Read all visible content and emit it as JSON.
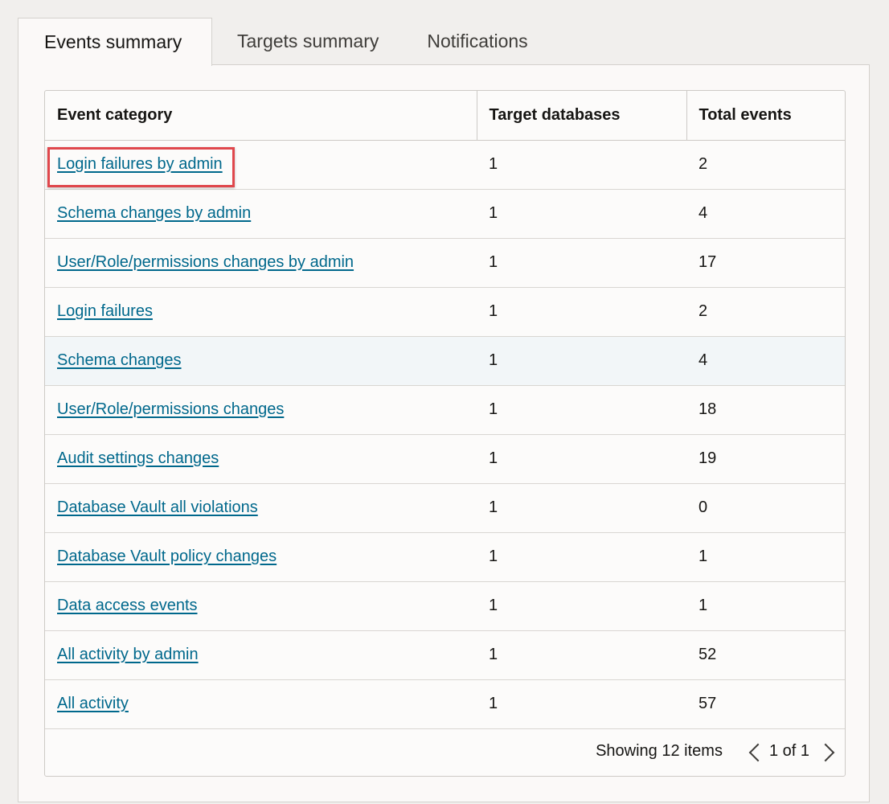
{
  "tabs": [
    {
      "label": "Events summary"
    },
    {
      "label": "Targets summary"
    },
    {
      "label": "Notifications"
    }
  ],
  "table": {
    "headers": [
      "Event category",
      "Target databases",
      "Total events"
    ],
    "rows": [
      {
        "category": "Login failures by admin",
        "targets": "1",
        "total": "2"
      },
      {
        "category": "Schema changes by admin",
        "targets": "1",
        "total": "4"
      },
      {
        "category": "User/Role/permissions changes by admin",
        "targets": "1",
        "total": "17"
      },
      {
        "category": "Login failures",
        "targets": "1",
        "total": "2"
      },
      {
        "category": "Schema changes",
        "targets": "1",
        "total": "4"
      },
      {
        "category": "User/Role/permissions changes",
        "targets": "1",
        "total": "18"
      },
      {
        "category": "Audit settings changes",
        "targets": "1",
        "total": "19"
      },
      {
        "category": "Database Vault all violations",
        "targets": "1",
        "total": "0"
      },
      {
        "category": "Database Vault policy changes",
        "targets": "1",
        "total": "1"
      },
      {
        "category": "Data access events",
        "targets": "1",
        "total": "1"
      },
      {
        "category": "All activity by admin",
        "targets": "1",
        "total": "52"
      },
      {
        "category": "All activity",
        "targets": "1",
        "total": "57"
      }
    ]
  },
  "footer": {
    "showing": "Showing 12 items",
    "page": "1 of 1"
  },
  "icons": {
    "prev": "chevron-left-icon",
    "next": "chevron-right-icon"
  },
  "colors": {
    "link": "#00688c",
    "highlight_box": "#e0474c"
  }
}
